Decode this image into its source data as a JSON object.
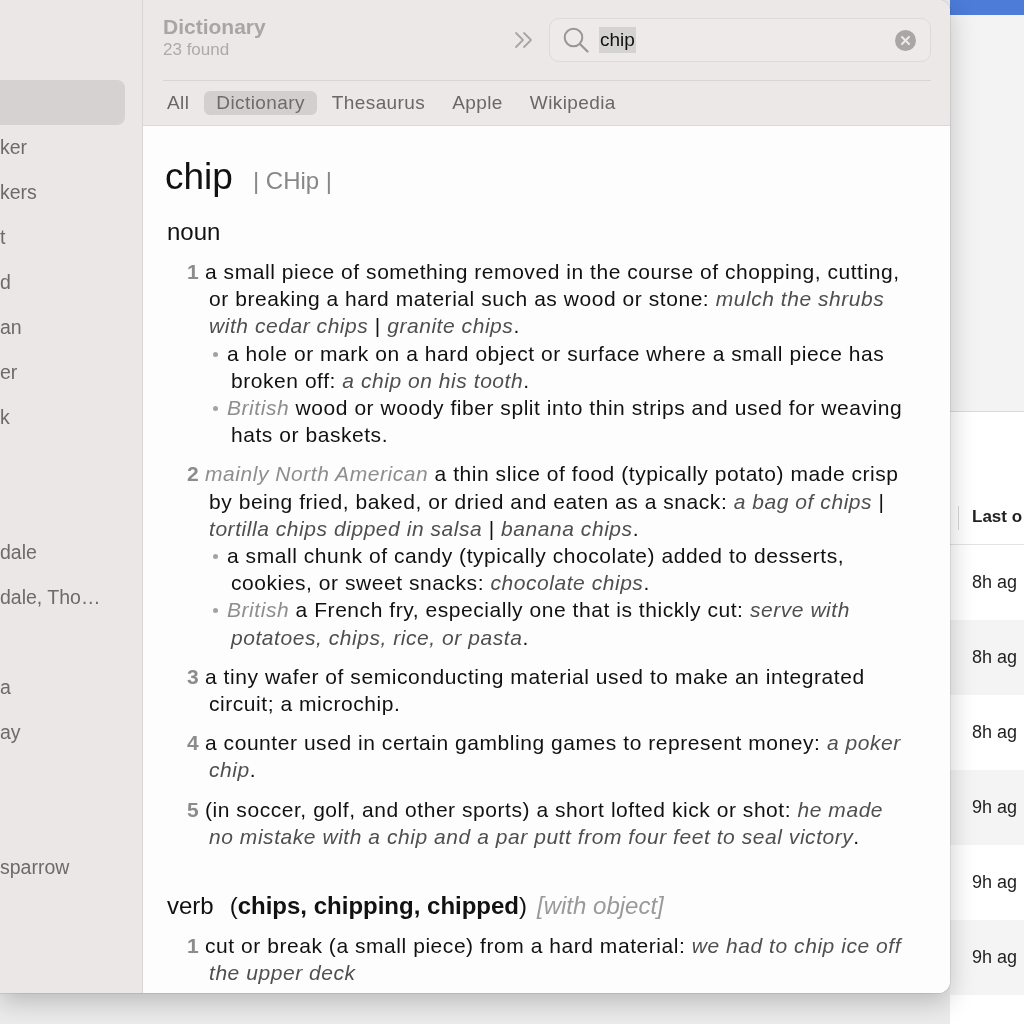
{
  "sidebar": {
    "items": [
      {
        "selected": true
      },
      {
        "label": "ker",
        "selected": false
      },
      {
        "label": "kers",
        "selected": false
      },
      {
        "label": "t",
        "selected": false
      },
      {
        "label": "d",
        "selected": false
      },
      {
        "label": "an",
        "selected": false
      },
      {
        "label": "er",
        "selected": false
      },
      {
        "label": "k",
        "selected": false
      },
      {
        "label": "dale",
        "selected": false
      },
      {
        "label": "dale, Tho…",
        "selected": false
      },
      {
        "label": "a",
        "selected": false
      },
      {
        "label": "ay",
        "selected": false
      },
      {
        "label": "sparrow",
        "selected": false
      }
    ]
  },
  "toolbar": {
    "title": "Dictionary",
    "count": "23 found",
    "search": {
      "value": "chip",
      "text_selected": true
    }
  },
  "tabs": [
    {
      "label": "All",
      "selected": false
    },
    {
      "label": "Dictionary",
      "selected": true
    },
    {
      "label": "Thesaurus",
      "selected": false
    },
    {
      "label": "Apple",
      "selected": false
    },
    {
      "label": "Wikipedia",
      "selected": false
    }
  ],
  "entry": {
    "headword": "chip",
    "pronunciation": "| CHip |",
    "sections": [
      {
        "part_of_speech": "noun",
        "senses": [
          {
            "number": "1",
            "text": "a small piece of something removed in the course of chopping, cutting, or breaking a hard material such as wood or stone: *mulch the shrubs with cedar chips* | *granite chips*.",
            "subsenses": [
              {
                "text": "a hole or mark on a hard object or surface where a small piece has broken off: *a chip on his tooth*."
              },
              {
                "label": "British",
                "text": "wood or woody fiber split into thin strips and used for weaving hats or baskets."
              }
            ]
          },
          {
            "number": "2",
            "label": "mainly North American",
            "text": "a thin slice of food (typically potato) made crisp by being fried, baked, or dried and eaten as a snack: *a bag of chips* | *tortilla chips dipped in salsa* | *banana chips*.",
            "subsenses": [
              {
                "text": "a small chunk of candy (typically chocolate) added to desserts, cookies, or sweet snacks: *chocolate chips*."
              },
              {
                "label": "British",
                "text": "a French fry, especially one that is thickly cut: *serve with potatoes, chips, rice, or pasta*."
              }
            ]
          },
          {
            "number": "3",
            "text": "a tiny wafer of semiconducting material used to make an integrated circuit; a microchip."
          },
          {
            "number": "4",
            "text": "a counter used in certain gambling games to represent money: *a poker chip*."
          },
          {
            "number": "5",
            "text": "(in soccer, golf, and other sports) a short lofted kick or shot: *he made no mistake with a chip and a par putt from four feet to seal victory*."
          }
        ]
      },
      {
        "part_of_speech": "verb",
        "forms": "(**chips, chipping, chipped**)",
        "grammar": "[with object]",
        "senses": [
          {
            "number": "1",
            "text": "cut or break (a small piece) from a hard material: *we had to chip ice off the upper deck*"
          }
        ]
      }
    ]
  },
  "background_window": {
    "table": {
      "columns": [
        "Last o"
      ],
      "rows": [
        [
          "8h ag"
        ],
        [
          "8h ag"
        ],
        [
          "8h ag"
        ],
        [
          "9h ag"
        ],
        [
          "9h ag"
        ],
        [
          "9h ag"
        ]
      ]
    }
  }
}
